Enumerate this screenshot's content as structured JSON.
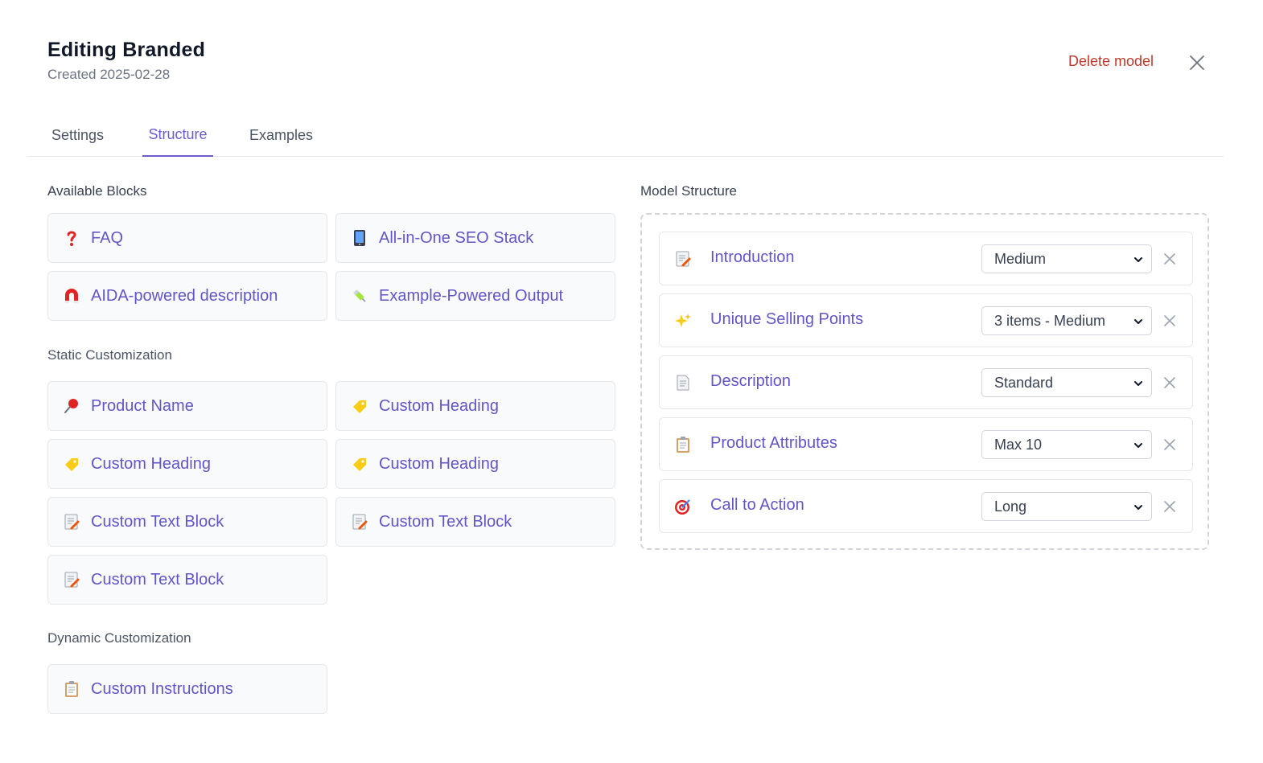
{
  "header": {
    "title": "Editing Branded",
    "subtitle": "Created 2025-02-28",
    "delete_label": "Delete model"
  },
  "tabs": [
    {
      "label": "Settings",
      "active": false
    },
    {
      "label": "Structure",
      "active": true
    },
    {
      "label": "Examples",
      "active": false
    }
  ],
  "available": {
    "heading": "Available Blocks",
    "blocks": [
      {
        "label": "FAQ",
        "icon": "question-icon"
      },
      {
        "label": "All-in-One SEO Stack",
        "icon": "phone-icon"
      },
      {
        "label": "AIDA-powered description",
        "icon": "magnet-icon"
      },
      {
        "label": "Example-Powered Output",
        "icon": "syringe-icon"
      }
    ]
  },
  "static": {
    "heading": "Static Customization",
    "blocks": [
      {
        "label": "Product Name",
        "icon": "pushpin-icon"
      },
      {
        "label": "Custom Heading",
        "icon": "tag-icon"
      },
      {
        "label": "Custom Heading",
        "icon": "tag-icon"
      },
      {
        "label": "Custom Heading",
        "icon": "tag-icon"
      },
      {
        "label": "Custom Text Block",
        "icon": "memo-icon"
      },
      {
        "label": "Custom Text Block",
        "icon": "memo-icon"
      },
      {
        "label": "Custom Text Block",
        "icon": "memo-icon"
      }
    ]
  },
  "dynamic": {
    "heading": "Dynamic Customization",
    "blocks": [
      {
        "label": "Custom Instructions",
        "icon": "clipboard-icon"
      }
    ]
  },
  "structure": {
    "heading": "Model Structure",
    "rows": [
      {
        "label": "Introduction",
        "icon": "memo-icon",
        "value": "Medium"
      },
      {
        "label": "Unique Selling Points",
        "icon": "sparkles-icon",
        "value": "3 items - Medium"
      },
      {
        "label": "Description",
        "icon": "page-icon",
        "value": "Standard"
      },
      {
        "label": "Product Attributes",
        "icon": "clipboard-icon",
        "value": "Max 10"
      },
      {
        "label": "Call to Action",
        "icon": "target-icon",
        "value": "Long"
      }
    ]
  },
  "colors": {
    "accent": "#6d5bd0",
    "link": "#6355c7",
    "danger": "#c0392b"
  }
}
